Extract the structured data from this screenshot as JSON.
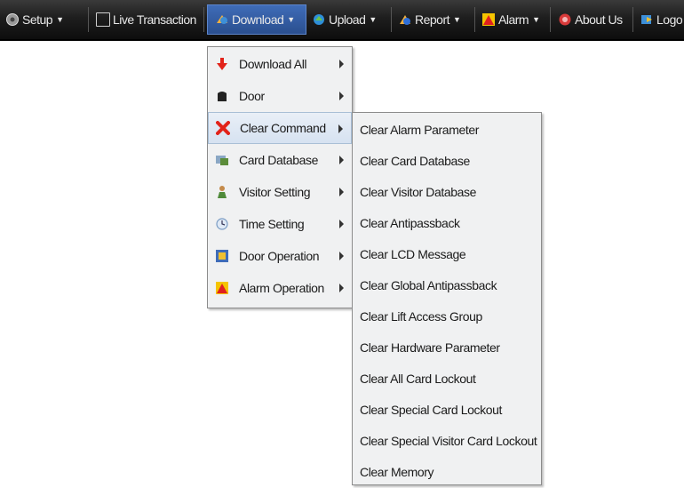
{
  "navbar": {
    "items": [
      {
        "label": "Setup",
        "icon": "setup-icon",
        "has_caret": true
      },
      {
        "label": "Live Transaction",
        "icon": "window-icon",
        "has_caret": false
      },
      {
        "label": "Download",
        "icon": "download-icon",
        "has_caret": true,
        "active": true
      },
      {
        "label": "Upload",
        "icon": "upload-icon",
        "has_caret": true
      },
      {
        "label": "Report",
        "icon": "report-icon",
        "has_caret": true
      },
      {
        "label": "Alarm",
        "icon": "alarm-icon",
        "has_caret": true
      },
      {
        "label": "About Us",
        "icon": "about-icon",
        "has_caret": false
      },
      {
        "label": "Logo",
        "icon": "logout-icon",
        "has_caret": false
      }
    ],
    "caret_glyph": "▼"
  },
  "download_menu": {
    "items": [
      {
        "label": "Download All",
        "icon": "red-down-arrow-icon"
      },
      {
        "label": "Door",
        "icon": "door-icon"
      },
      {
        "label": "Clear Command",
        "icon": "red-x-icon",
        "hovered": true
      },
      {
        "label": "Card Database",
        "icon": "card-database-icon"
      },
      {
        "label": "Visitor Setting",
        "icon": "visitor-icon"
      },
      {
        "label": "Time Setting",
        "icon": "clock-icon"
      },
      {
        "label": "Door Operation",
        "icon": "door-operation-icon"
      },
      {
        "label": "Alarm Operation",
        "icon": "alarm-operation-icon"
      }
    ]
  },
  "clear_command_submenu": {
    "items": [
      {
        "label": "Clear Alarm Parameter"
      },
      {
        "label": "Clear Card Database"
      },
      {
        "label": "Clear Visitor Database"
      },
      {
        "label": "Clear Antipassback"
      },
      {
        "label": "Clear LCD Message"
      },
      {
        "label": "Clear Global Antipassback"
      },
      {
        "label": "Clear Lift Access Group"
      },
      {
        "label": "Clear Hardware Parameter"
      },
      {
        "label": "Clear All Card Lockout"
      },
      {
        "label": "Clear Special Card Lockout"
      },
      {
        "label": "Clear Special Visitor Card Lockout"
      },
      {
        "label": "Clear Memory"
      }
    ]
  },
  "colors": {
    "navbar_bg": "#1e1e1e",
    "active_tab": "#3f6cb8",
    "menu_bg": "#f0f1f2",
    "hover_bg": "#d6e2f1"
  }
}
